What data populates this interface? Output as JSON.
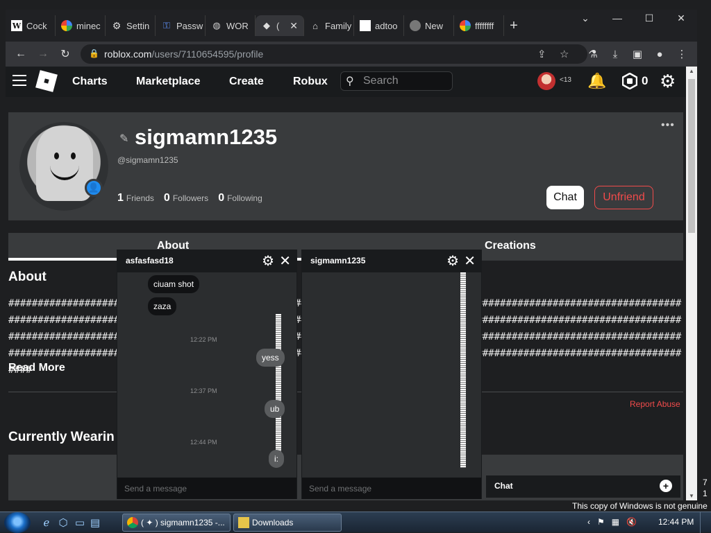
{
  "browser": {
    "tabs": [
      {
        "label": "Cock",
        "icon": "w-icon",
        "active": false
      },
      {
        "label": "minec",
        "icon": "google-icon",
        "active": false
      },
      {
        "label": "Settin",
        "icon": "gear-icon",
        "active": false
      },
      {
        "label": "Passw",
        "icon": "key-icon",
        "active": false
      },
      {
        "label": "WOR",
        "icon": "globe-icon",
        "active": false
      },
      {
        "label": "(",
        "icon": "roblox-icon",
        "active": true
      },
      {
        "label": "Family",
        "icon": "bank-icon",
        "active": false
      },
      {
        "label": "adtoo",
        "icon": "blank-icon",
        "active": false
      },
      {
        "label": "New",
        "icon": "chrome-icon",
        "active": false
      },
      {
        "label": "ffffffff",
        "icon": "google-icon",
        "active": false
      }
    ],
    "new_tab": "+",
    "url_host": "roblox.com",
    "url_path": "/users/7110654595/profile"
  },
  "header": {
    "nav": [
      "Charts",
      "Marketplace",
      "Create",
      "Robux"
    ],
    "search_placeholder": "Search",
    "age_label": "<13",
    "robux_count": "0"
  },
  "profile": {
    "username": "sigmamn1235",
    "handle": "@sigmamn1235",
    "friends_count": "1",
    "friends_label": "Friends",
    "followers_count": "0",
    "followers_label": "Followers",
    "following_count": "0",
    "following_label": "Following",
    "more": "•••",
    "chat_button": "Chat",
    "unfriend_button": "Unfriend"
  },
  "tabs": {
    "about": "About",
    "creations": "Creations"
  },
  "about": {
    "heading": "About",
    "hash_line": "################################################################################################################################################################################################################################################################################################################################################################################################################################################################################",
    "read_more": "Read More",
    "report_abuse": "Report Abuse",
    "currently_wearing": "Currently Wearin"
  },
  "chat_windows": [
    {
      "name": "asfasfasd18",
      "messages_in": [
        "ciuam shot",
        "zaza"
      ],
      "timestamps": [
        "12:22 PM",
        "12:37 PM",
        "12:44 PM"
      ],
      "messages_out": [
        "yess",
        "ub",
        "i:"
      ],
      "input_placeholder": "Send a message"
    },
    {
      "name": "sigmamn1235",
      "input_placeholder": "Send a message"
    }
  ],
  "chat_dock": {
    "label": "Chat",
    "plus": "+"
  },
  "windows": {
    "notice": "This copy of Windows is not genuine",
    "side_digits": [
      "7",
      "1"
    ],
    "taskbar_buttons": [
      "( ✦ ) sigmamn1235 -...",
      "Downloads"
    ],
    "clock": "12:44 PM"
  }
}
